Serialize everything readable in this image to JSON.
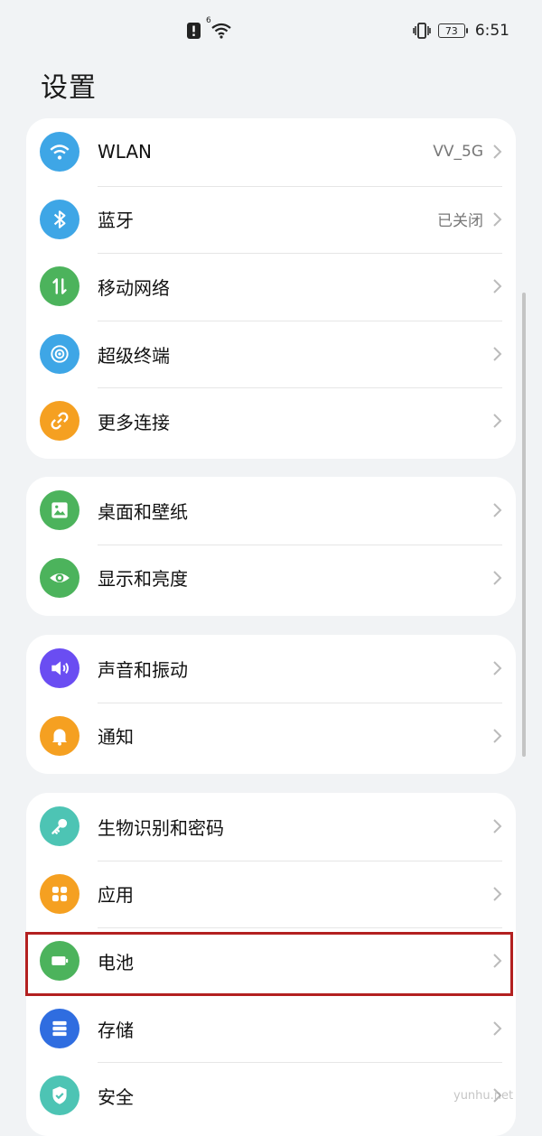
{
  "status_bar": {
    "time": "6:51",
    "battery_level": "73",
    "network_badge": "6",
    "icons": [
      "notification-alert-icon",
      "wifi-icon",
      "vibrate-icon",
      "battery-icon"
    ]
  },
  "page_title": "设置",
  "groups": [
    {
      "items": [
        {
          "label": "WLAN",
          "value": "VV_5G",
          "icon": "wifi-icon",
          "color": "#3ea6e6"
        },
        {
          "label": "蓝牙",
          "value": "已关闭",
          "icon": "bluetooth-icon",
          "color": "#3ea6e6"
        },
        {
          "label": "移动网络",
          "value": "",
          "icon": "mobile-data-icon",
          "color": "#4cb35c"
        },
        {
          "label": "超级终端",
          "value": "",
          "icon": "super-device-icon",
          "color": "#3ea6e6"
        },
        {
          "label": "更多连接",
          "value": "",
          "icon": "link-icon",
          "color": "#f5a021"
        }
      ]
    },
    {
      "items": [
        {
          "label": "桌面和壁纸",
          "value": "",
          "icon": "wallpaper-icon",
          "color": "#4cb35c"
        },
        {
          "label": "显示和亮度",
          "value": "",
          "icon": "eye-icon",
          "color": "#4cb35c"
        }
      ]
    },
    {
      "items": [
        {
          "label": "声音和振动",
          "value": "",
          "icon": "speaker-icon",
          "color": "#6a4df2"
        },
        {
          "label": "通知",
          "value": "",
          "icon": "bell-icon",
          "color": "#f5a021"
        }
      ]
    },
    {
      "items": [
        {
          "label": "生物识别和密码",
          "value": "",
          "icon": "key-icon",
          "color": "#4dc4b4"
        },
        {
          "label": "应用",
          "value": "",
          "icon": "apps-icon",
          "color": "#f5a021"
        },
        {
          "label": "电池",
          "value": "",
          "icon": "battery-icon",
          "color": "#4cb35c"
        },
        {
          "label": "存储",
          "value": "",
          "icon": "storage-icon",
          "color": "#2f6de0"
        },
        {
          "label": "安全",
          "value": "",
          "icon": "shield-icon",
          "color": "#4dc4b4"
        }
      ]
    }
  ],
  "watermark": "yunhu.net"
}
